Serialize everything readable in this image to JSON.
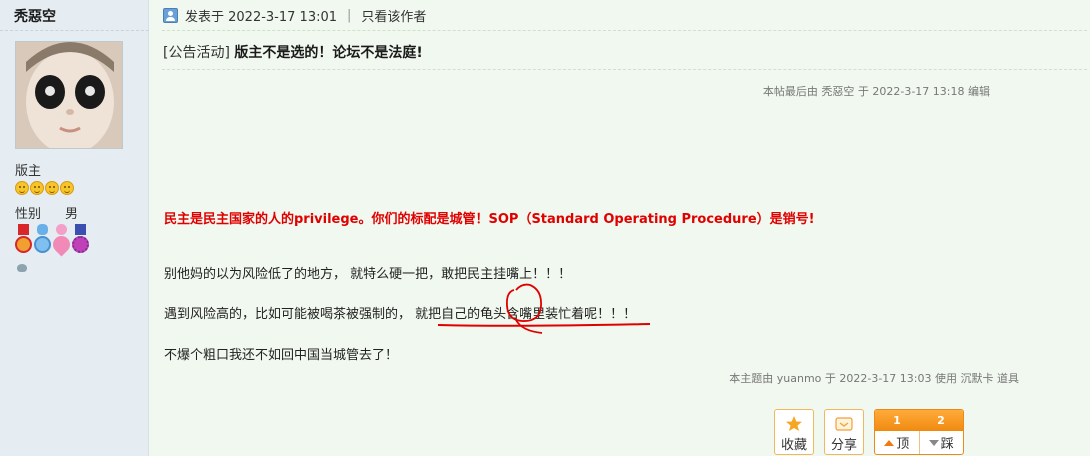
{
  "author": {
    "name": "秃惡空",
    "role": "版主",
    "gender_label": "性别",
    "gender_value": "男"
  },
  "post": {
    "posted_on_label": "发表于 2022-3-17 13:01",
    "only_author_label": "只看该作者",
    "separator": "|",
    "category": "[公告活动]",
    "title": "版主不是选的！论坛不是法庭!",
    "edited_note": "本帖最后由 秃惡空 于 2022-3-17 13:18 编辑",
    "red_line": "民主是民主国家的人的privilege。你们的标配是城管！SOP（Standard Operating Procedure）是销号!",
    "paragraphs": [
      "别他妈的以为风险低了的地方， 就特么硬一把，敢把民主挂嘴上！！！",
      "遇到风险高的，比如可能被喝茶被强制的， 就把自己的龟头含嘴里装忙着呢！！！",
      "不爆个粗口我还不如回中国当城管去了！"
    ],
    "replied_note": "本主题由 yuanmo 于 2022-3-17 13:03 使用 沉默卡 道具"
  },
  "actions": {
    "favorite_label": "收藏",
    "share_label": "分享",
    "upvote_count": "1",
    "downvote_count": "2",
    "upvote_label": "顶",
    "downvote_label": "踩"
  },
  "colors": {
    "page_bg": "#f1f8ef",
    "sidebar_bg": "#e5edf2",
    "emphasis_red": "#e00000",
    "vote_orange": "#f08a10"
  },
  "icons": [
    "user-icon",
    "star-icon",
    "favorite-icon",
    "share-icon",
    "thumb-up-arrow-icon",
    "thumb-down-arrow-icon"
  ]
}
